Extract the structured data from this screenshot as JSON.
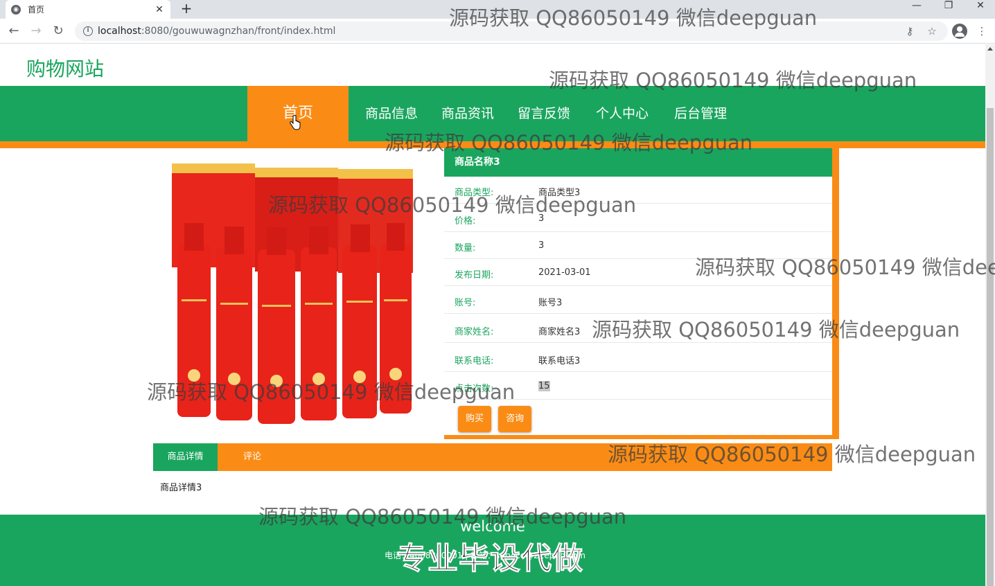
{
  "browser": {
    "tab_title": "首页",
    "url_host": "localhost",
    "url_path": ":8080/gouwuwagnzhan/front/index.html"
  },
  "site": {
    "logo": "购物网站"
  },
  "nav": {
    "home": "首页",
    "items": [
      "商品信息",
      "商品资讯",
      "留言反馈",
      "个人中心",
      "后台管理"
    ]
  },
  "product": {
    "name": "商品名称3",
    "rows": [
      {
        "label": "商品类型:",
        "value": "商品类型3"
      },
      {
        "label": "价格:",
        "value": "3"
      },
      {
        "label": "数量:",
        "value": "3"
      },
      {
        "label": "发布日期:",
        "value": "2021-03-01"
      },
      {
        "label": "账号:",
        "value": "账号3"
      },
      {
        "label": "商家姓名:",
        "value": "商家姓名3"
      },
      {
        "label": "联系电话:",
        "value": "联系电话3"
      },
      {
        "label": "点击次数:",
        "value": "15"
      }
    ],
    "buy_label": "购买",
    "ask_label": "咨询"
  },
  "tabs": {
    "detail": "商品详情",
    "comment": "评论",
    "content": "商品详情3"
  },
  "footer": {
    "welcome": "welcome",
    "contact": "电话：4008200001 | 邮箱：service@21epub.com"
  },
  "watermark": {
    "text": "源码获取 QQ86050149 微信deepguan",
    "big": "专业毕设代做"
  },
  "colors": {
    "green": "#1aa55e",
    "orange": "#fa8c16"
  }
}
